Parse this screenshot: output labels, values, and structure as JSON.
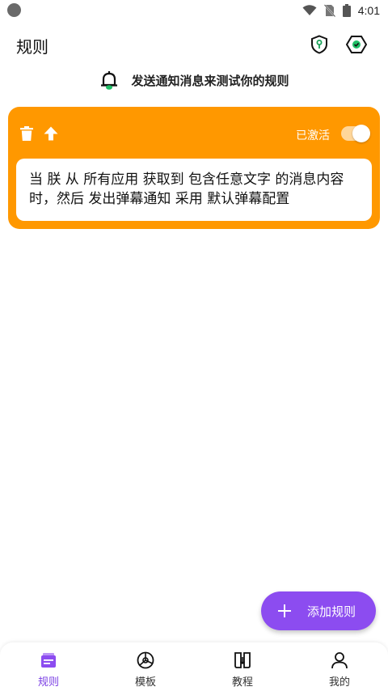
{
  "status_bar": {
    "time": "4:01"
  },
  "app_bar": {
    "title": "规则"
  },
  "notify_test": {
    "label": "发送通知消息来测试你的规则"
  },
  "rule_card": {
    "status_label": "已激活",
    "enabled": true,
    "description_line1": "当 朕 从 所有应用 获取到 包含任意文字 的消息内容",
    "description_line2": "时，然后 发出弹幕通知 采用 默认弹幕配置",
    "color": "#ff9800"
  },
  "fab": {
    "label": "添加规则",
    "color": "#8c4cf0"
  },
  "bottom_nav": {
    "items": [
      {
        "label": "规则",
        "icon": "rules-icon",
        "active": true
      },
      {
        "label": "模板",
        "icon": "template-icon",
        "active": false
      },
      {
        "label": "教程",
        "icon": "tutorial-icon",
        "active": false
      },
      {
        "label": "我的",
        "icon": "profile-icon",
        "active": false
      }
    ],
    "active_color": "#7b3fe4"
  }
}
